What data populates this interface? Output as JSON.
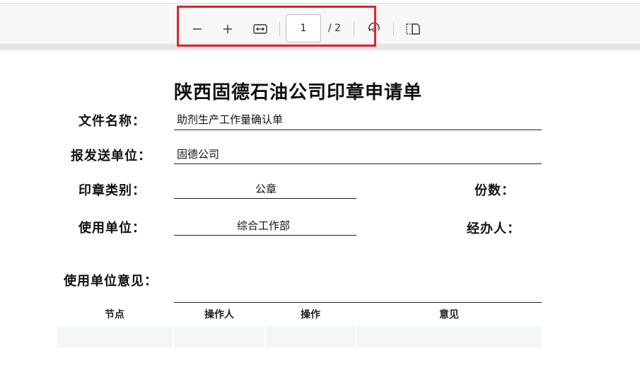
{
  "toolbar": {
    "zoom_out_icon": "minus-icon",
    "zoom_in_icon": "plus-icon",
    "fit_width_icon": "fit-width-icon",
    "current_page": "1",
    "page_total": "/ 2",
    "rotate_icon": "rotate-icon",
    "page_view_icon": "page-view-icon",
    "highlight_color": "#e0242b"
  },
  "document": {
    "title": "陕西固德石油公司印章申请单",
    "file_name_label": "文件名称：",
    "file_name_value": "助剂生产工作量确认单",
    "submit_unit_label": "报发送单位：",
    "submit_unit_value": "固德公司",
    "seal_type_label": "印章类别：",
    "seal_type_value": "公章",
    "copies_label": "份数：",
    "use_unit_label": "使用单位：",
    "use_unit_value": "综合工作部",
    "handler_label": "经办人：",
    "opinion_label": "使用单位意见：",
    "table_headers": [
      "节点",
      "操作人",
      "操作",
      "意见"
    ]
  }
}
